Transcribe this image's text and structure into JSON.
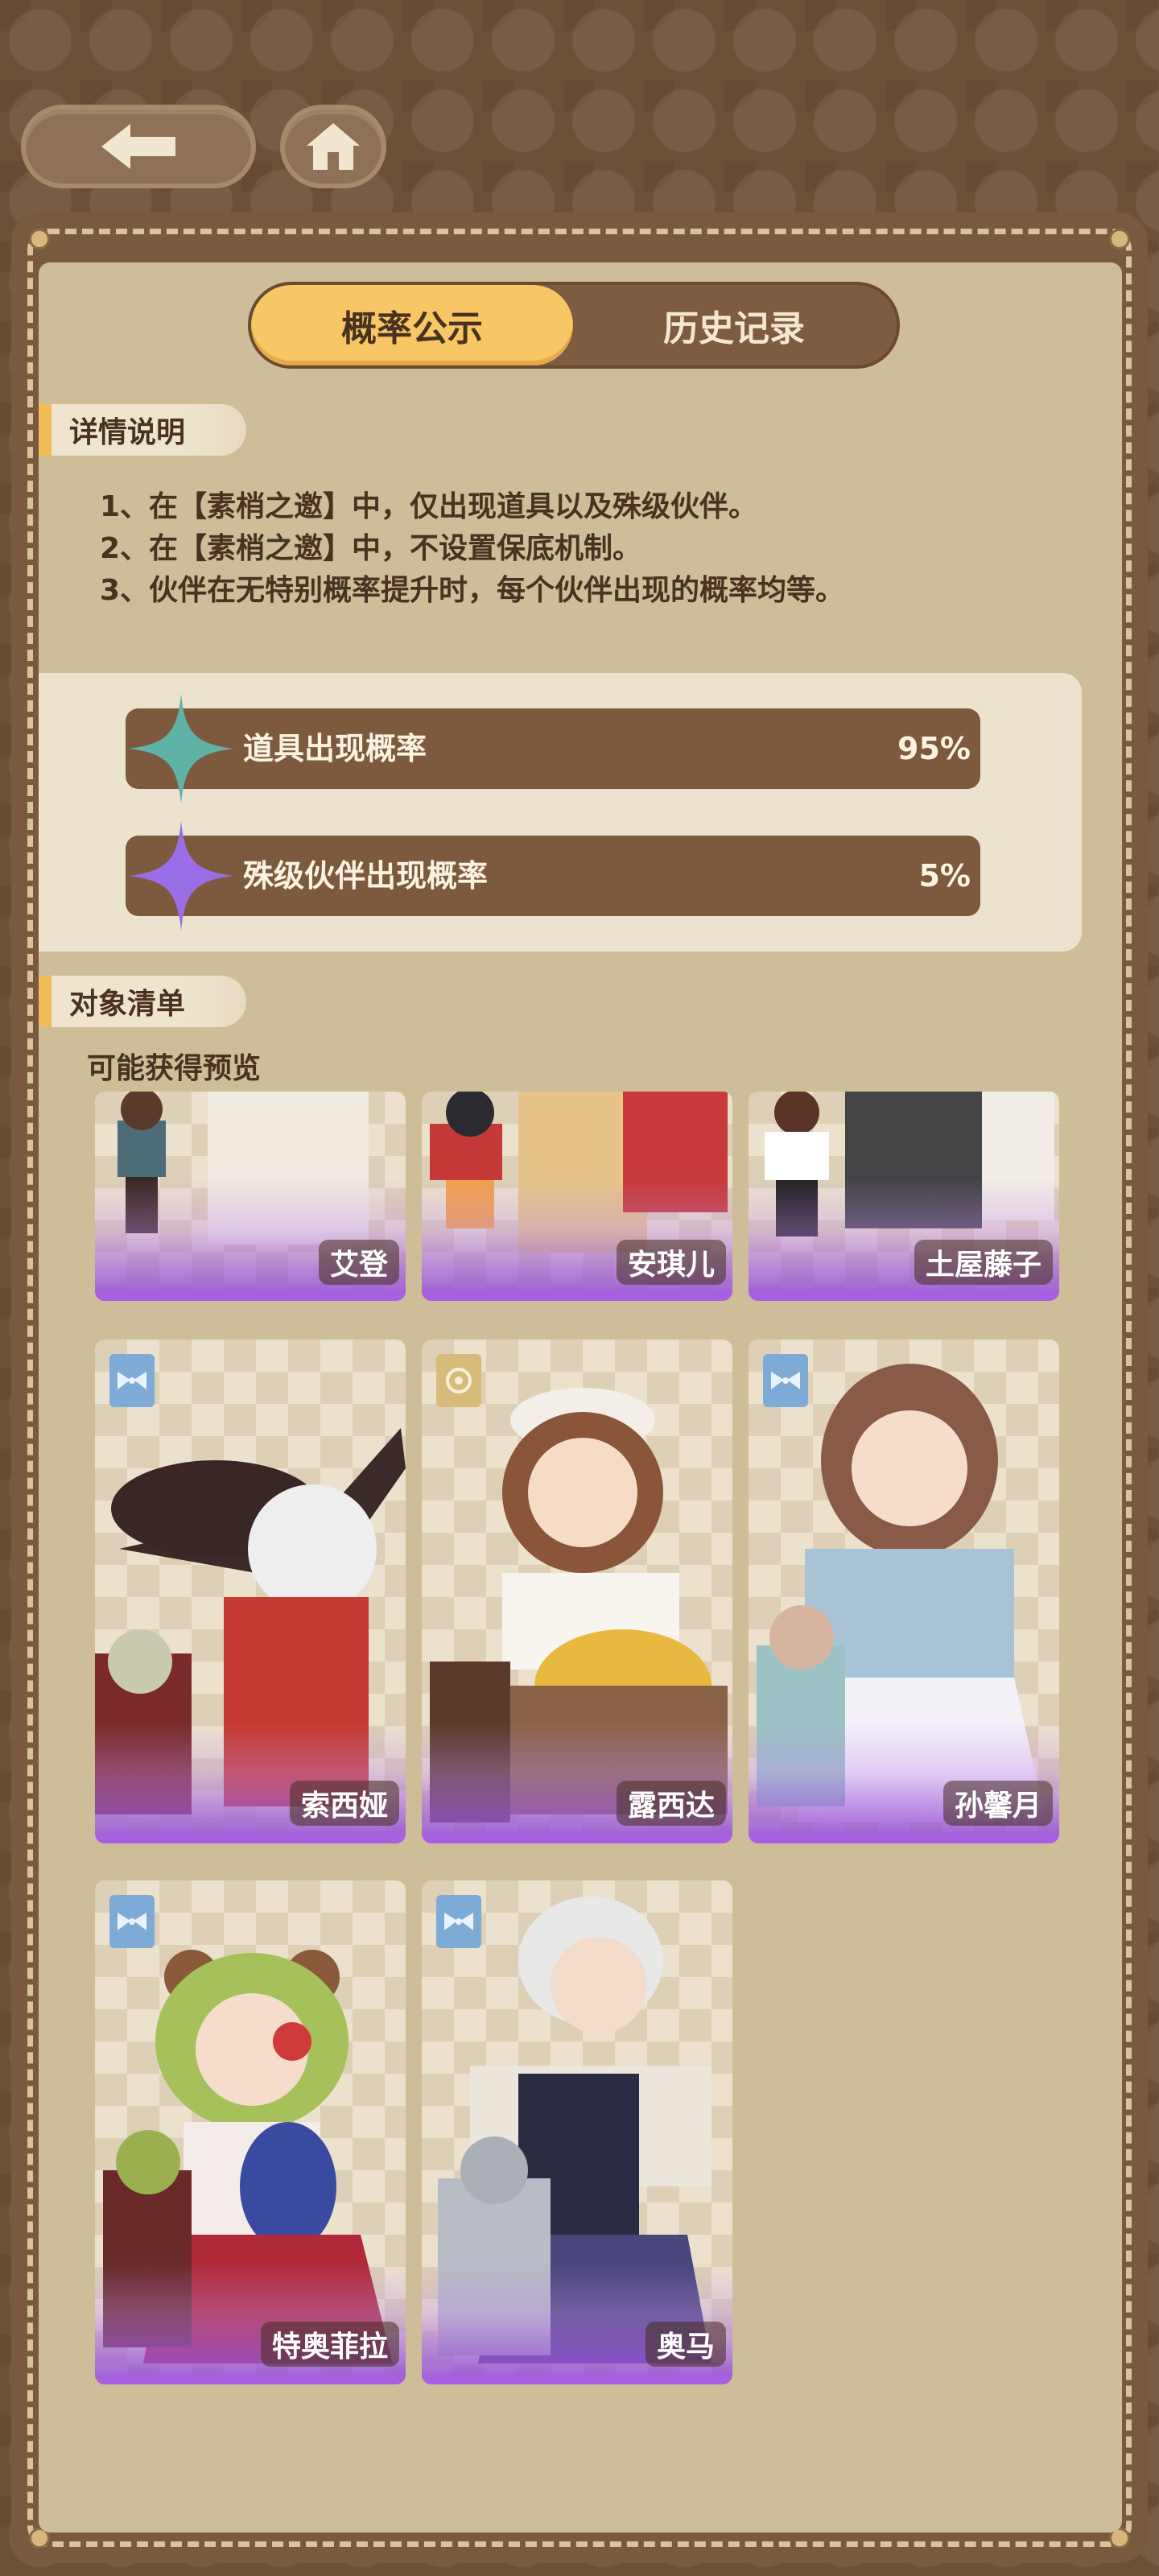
{
  "nav": {
    "back_icon": "arrow-left-icon",
    "home_icon": "home-icon"
  },
  "tabs": [
    {
      "label": "概率公示",
      "active": true
    },
    {
      "label": "历史记录",
      "active": false
    }
  ],
  "details": {
    "heading": "详情说明",
    "lines": [
      "1、在【素梢之邀】中，仅出现道具以及殊级伙伴。",
      "2、在【素梢之邀】中，不设置保底机制。",
      "3、伙伴在无特别概率提升时，每个伙伴出现的概率均等。"
    ]
  },
  "rates": [
    {
      "label": "道具出现概率",
      "value": "95%",
      "icon": "teal-sparkle-icon",
      "color": "#5fb3a6"
    },
    {
      "label": "殊级伙伴出现概率",
      "value": "5%",
      "icon": "purple-sparkle-icon",
      "color": "#9a6ee6"
    }
  ],
  "objects": {
    "heading": "对象清单",
    "preview_label": "可能获得预览",
    "cards": [
      {
        "name": "艾登"
      },
      {
        "name": "安琪儿"
      },
      {
        "name": "土屋藤子"
      },
      {
        "name": "索西娅",
        "badge": "bow-badge-icon"
      },
      {
        "name": "露西达",
        "badge": "gold-emblem-icon"
      },
      {
        "name": "孙馨月",
        "badge": "bow-badge-icon"
      },
      {
        "name": "特奥菲拉",
        "badge": "bow-badge-icon"
      },
      {
        "name": "奥马",
        "badge": "bow-badge-icon"
      }
    ]
  },
  "colors": {
    "accent_yellow": "#f7c765",
    "brown": "#7d5a3e",
    "card_purple": "#a85fe0"
  }
}
